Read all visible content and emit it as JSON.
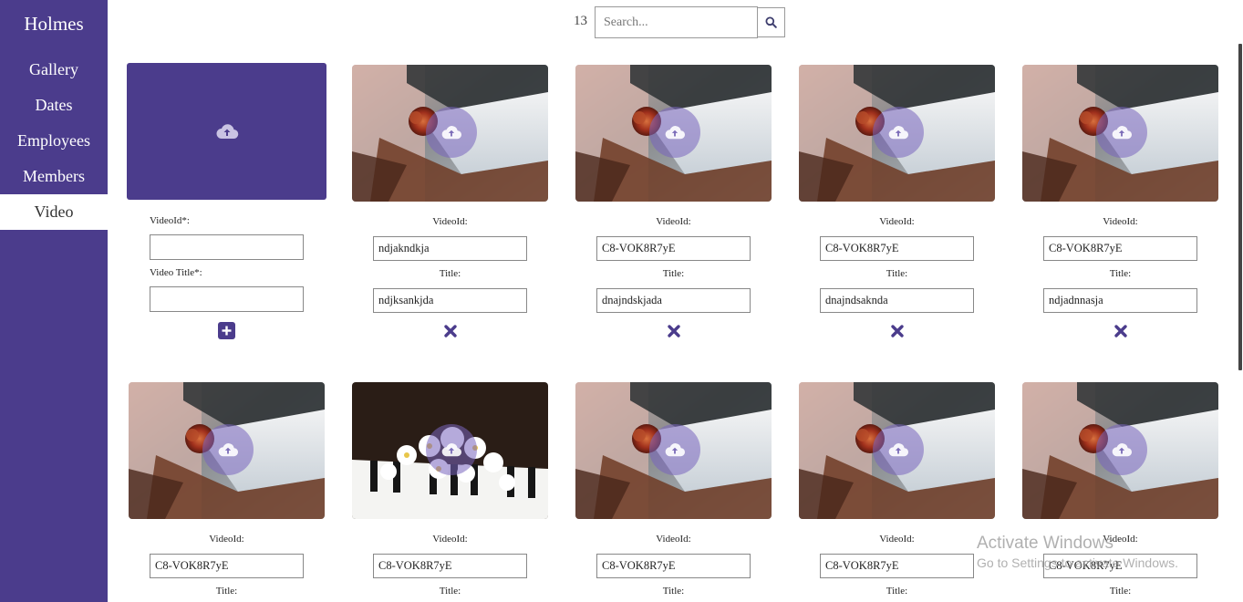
{
  "sidebar": {
    "brand": "Holmes",
    "items": [
      {
        "label": "Gallery"
      },
      {
        "label": "Dates"
      },
      {
        "label": "Employees"
      },
      {
        "label": "Members"
      },
      {
        "label": "Video"
      }
    ],
    "active_item": "Video",
    "bg_color": "#4b3c8c"
  },
  "toolbar": {
    "count": "13",
    "search_placeholder": "Search...",
    "search_icon": "search-icon"
  },
  "add_form": {
    "upload_icon": "cloud-upload-icon",
    "video_id_label": "VideoId*:",
    "video_id_value": "",
    "title_label": "Video Title*:",
    "title_value": "",
    "add_icon": "plus-square-icon"
  },
  "videos": [
    {
      "image": "piano-rose",
      "video_id_label": "VideoId:",
      "video_id": "ndjakndkja",
      "title_label": "Title:",
      "title": "ndjksankjda"
    },
    {
      "image": "piano-rose",
      "video_id_label": "VideoId:",
      "video_id": "C8-VOK8R7yE",
      "title_label": "Title:",
      "title": "dnajndskjada"
    },
    {
      "image": "piano-rose",
      "video_id_label": "VideoId:",
      "video_id": "C8-VOK8R7yE",
      "title_label": "Title:",
      "title": "dnajndsaknda"
    },
    {
      "image": "piano-rose",
      "video_id_label": "VideoId:",
      "video_id": "C8-VOK8R7yE",
      "title_label": "Title:",
      "title": "ndjadnnasja"
    },
    {
      "image": "piano-rose",
      "video_id_label": "VideoId:",
      "video_id": "C8-VOK8R7yE",
      "title_label": "Title:"
    },
    {
      "image": "piano-flowers",
      "video_id_label": "VideoId:",
      "video_id": "C8-VOK8R7yE",
      "title_label": "Title:"
    },
    {
      "image": "piano-rose",
      "video_id_label": "VideoId:",
      "video_id": "C8-VOK8R7yE",
      "title_label": "Title:"
    },
    {
      "image": "piano-rose",
      "video_id_label": "VideoId:",
      "video_id": "C8-VOK8R7yE",
      "title_label": "Title:"
    },
    {
      "image": "piano-rose",
      "video_id_label": "VideoId:",
      "video_id": "C8-VOK8R7yE",
      "title_label": "Title:"
    }
  ],
  "watermark": {
    "line1": "Activate Windows",
    "line2": "Go to Settings to activate Windows."
  }
}
